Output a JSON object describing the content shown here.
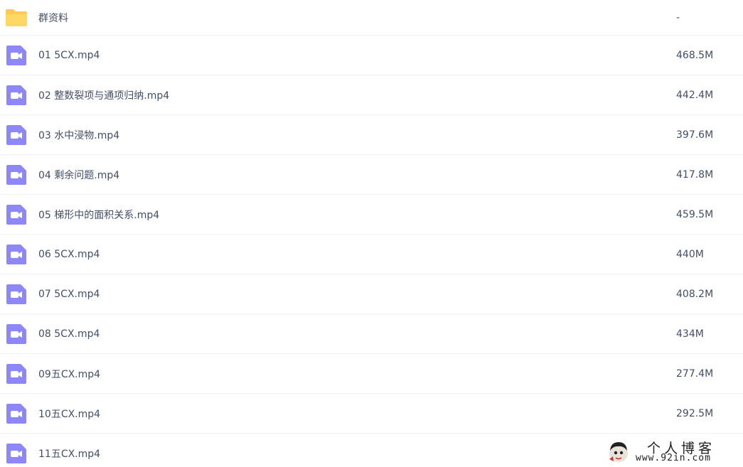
{
  "colors": {
    "folder_icon": "#fdcb53",
    "video_icon": "#8d87f7",
    "text": "#424e67",
    "divider": "#f1f2f5"
  },
  "files": [
    {
      "name": "群资料",
      "size": "-",
      "icon": "folder-icon"
    },
    {
      "name": "01 5CX.mp4",
      "size": "468.5M",
      "icon": "video-icon"
    },
    {
      "name": "02 整数裂项与通项归纳.mp4",
      "size": "442.4M",
      "icon": "video-icon"
    },
    {
      "name": "03 水中浸物.mp4",
      "size": "397.6M",
      "icon": "video-icon"
    },
    {
      "name": "04 剩余问题.mp4",
      "size": "417.8M",
      "icon": "video-icon"
    },
    {
      "name": "05 梯形中的面积关系.mp4",
      "size": "459.5M",
      "icon": "video-icon"
    },
    {
      "name": "06 5CX.mp4",
      "size": "440M",
      "icon": "video-icon"
    },
    {
      "name": "07 5CX.mp4",
      "size": "408.2M",
      "icon": "video-icon"
    },
    {
      "name": "08 5CX.mp4",
      "size": "434M",
      "icon": "video-icon"
    },
    {
      "name": "09五CX.mp4",
      "size": "277.4M",
      "icon": "video-icon"
    },
    {
      "name": "10五CX.mp4",
      "size": "292.5M",
      "icon": "video-icon"
    },
    {
      "name": "11五CX.mp4",
      "size": "",
      "icon": "video-icon"
    }
  ],
  "watermark": {
    "title": "个人博客",
    "url": "www.92in.com"
  }
}
